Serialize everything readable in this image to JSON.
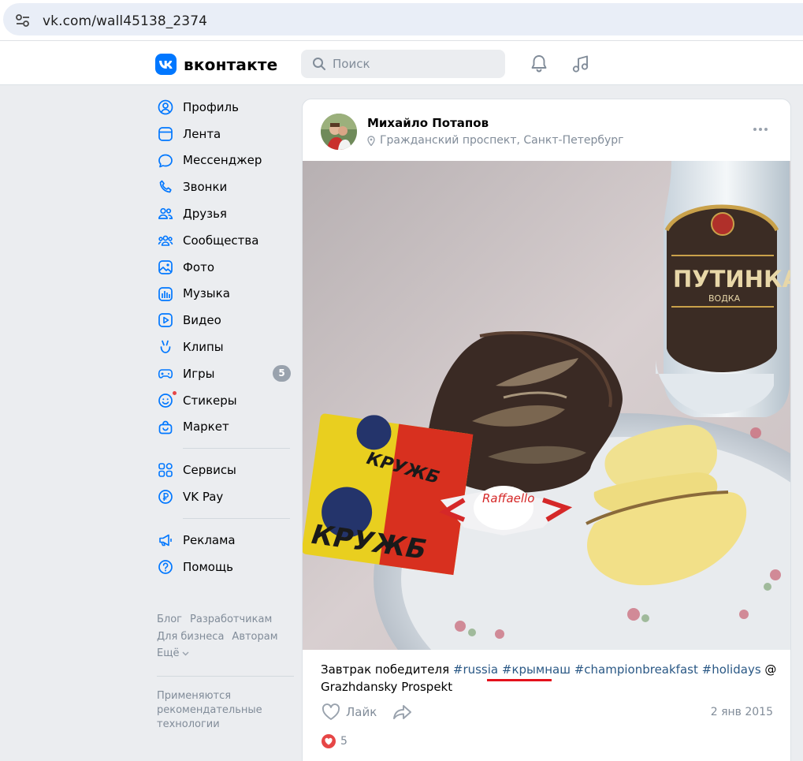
{
  "browser": {
    "url": "vk.com/wall45138_2374"
  },
  "header": {
    "brand": "вконтакте",
    "search_placeholder": "Поиск"
  },
  "sidebar": {
    "items": [
      {
        "label": "Профиль",
        "icon": "user-icon"
      },
      {
        "label": "Лента",
        "icon": "feed-icon"
      },
      {
        "label": "Мессенджер",
        "icon": "messenger-icon"
      },
      {
        "label": "Звонки",
        "icon": "phone-icon"
      },
      {
        "label": "Друзья",
        "icon": "friends-icon"
      },
      {
        "label": "Сообщества",
        "icon": "communities-icon"
      },
      {
        "label": "Фото",
        "icon": "photo-icon"
      },
      {
        "label": "Музыка",
        "icon": "music-icon"
      },
      {
        "label": "Видео",
        "icon": "video-icon"
      },
      {
        "label": "Клипы",
        "icon": "clips-icon"
      },
      {
        "label": "Игры",
        "icon": "games-icon",
        "badge": "5"
      },
      {
        "label": "Стикеры",
        "icon": "stickers-icon"
      },
      {
        "label": "Маркет",
        "icon": "market-icon"
      }
    ],
    "items2": [
      {
        "label": "Сервисы",
        "icon": "services-icon"
      },
      {
        "label": "VK Pay",
        "icon": "vkpay-icon"
      }
    ],
    "items3": [
      {
        "label": "Реклама",
        "icon": "ads-icon"
      },
      {
        "label": "Помощь",
        "icon": "help-icon"
      }
    ],
    "footer": {
      "blog": "Блог",
      "developers": "Разработчикам",
      "business": "Для бизнеса",
      "authors": "Авторам",
      "more": "Ещё"
    },
    "recommend_text": "Применяются рекомендательные технологии"
  },
  "post": {
    "author": "Михайло Потапов",
    "location": "Гражданский проспект, Санкт-Петербург",
    "text_plain": "Завтрак победителя",
    "tags": [
      "#russia",
      "#крымнаш",
      "#championbreakfast",
      "#holidays"
    ],
    "text_suffix": "@ Grazhdansky Prospekt",
    "like_label": "Лайк",
    "date": "2 янв 2015",
    "likes": "5",
    "photo_labels": {
      "bottle": "ПУТИНКА",
      "bottle_sub": "ВОДКА",
      "cheese": "КРУЖБ",
      "candy": "Raffaello"
    }
  },
  "colors": {
    "accent": "#0077ff",
    "link": "#2a5885",
    "highlight": "#e4111c",
    "heart": "#e64646"
  }
}
